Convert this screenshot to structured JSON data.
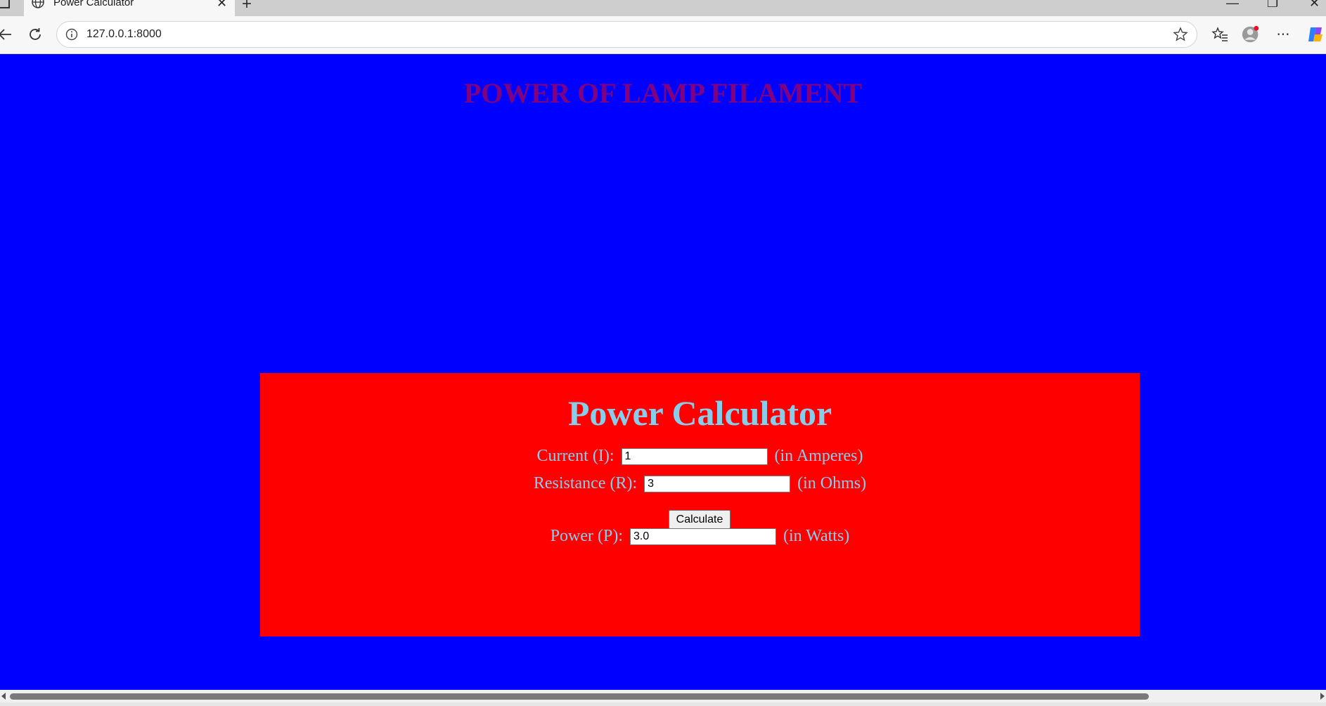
{
  "browser": {
    "tab_title": "Power Calculator",
    "url": "127.0.0.1:8000",
    "icons": [
      "globe-icon",
      "close-icon",
      "new-tab-icon",
      "minimize-icon",
      "restore-icon",
      "window-close-icon",
      "back-icon",
      "reload-icon",
      "site-info-icon",
      "favorite-star-icon",
      "favorites-icon",
      "profile-icon",
      "more-options-icon",
      "copilot-icon"
    ],
    "colors": {
      "tabbar": "#cecece",
      "toolbar": "#f7f7f7"
    }
  },
  "page": {
    "heading": "POWER OF LAMP FILAMENT",
    "colors": {
      "background": "#0000ff",
      "heading": "#800080",
      "card": "#ff0000",
      "card_text": "#87ceeb"
    }
  },
  "calculator": {
    "title": "Power Calculator",
    "current": {
      "label": "Current (I):",
      "value": "1",
      "unit": "(in Amperes)"
    },
    "resistance": {
      "label": "Resistance (R):",
      "value": "3",
      "unit": "(in Ohms)"
    },
    "calculate_label": "Calculate",
    "power": {
      "label": "Power (P):",
      "value": "3.0",
      "unit": "(in Watts)"
    }
  }
}
